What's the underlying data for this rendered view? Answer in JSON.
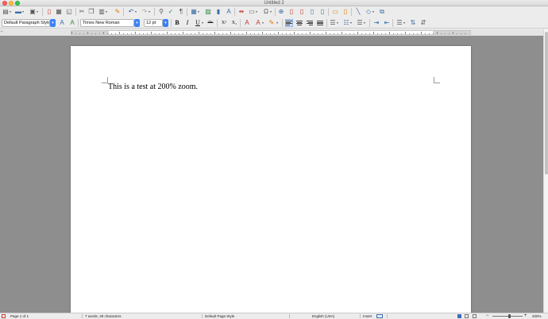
{
  "window": {
    "title": "Untitled 2"
  },
  "toolbar_icons": [
    "new-document-icon",
    "open-folder-icon",
    "save-icon",
    "export-pdf-icon",
    "print-icon",
    "print-preview-icon",
    "cut-icon",
    "copy-icon",
    "paste-icon",
    "clone-formatting-icon",
    "undo-icon",
    "redo-icon",
    "find-replace-icon",
    "spellcheck-icon",
    "formatting-marks-icon",
    "insert-table-icon",
    "insert-image-icon",
    "insert-chart-icon",
    "insert-textbox-icon",
    "page-break-icon",
    "insert-field-icon",
    "special-character-icon",
    "hyperlink-icon",
    "footnote-icon",
    "endnote-icon",
    "bookmark-icon",
    "cross-reference-icon",
    "comment-icon",
    "track-changes-icon",
    "line-icon",
    "basic-shapes-icon",
    "draw-functions-icon"
  ],
  "formatting": {
    "paragraph_style": "Default Paragraph Style",
    "font_name": "Times New Roman",
    "font_size": "12 pt",
    "strikethrough_label": "abc",
    "superscript_label": "X²",
    "subscript_label": "X₂"
  },
  "document": {
    "text": "This is a test at 200% zoom."
  },
  "status": {
    "page": "Page 1 of 1",
    "words": "7 words, 28 characters",
    "page_style": "Default Page Style",
    "language": "English (USA)",
    "mode": "Insert",
    "zoom": "200%"
  },
  "colors": {
    "accent": "#3b82f6",
    "workspace": "#8e8e8e",
    "page": "#ffffff"
  }
}
